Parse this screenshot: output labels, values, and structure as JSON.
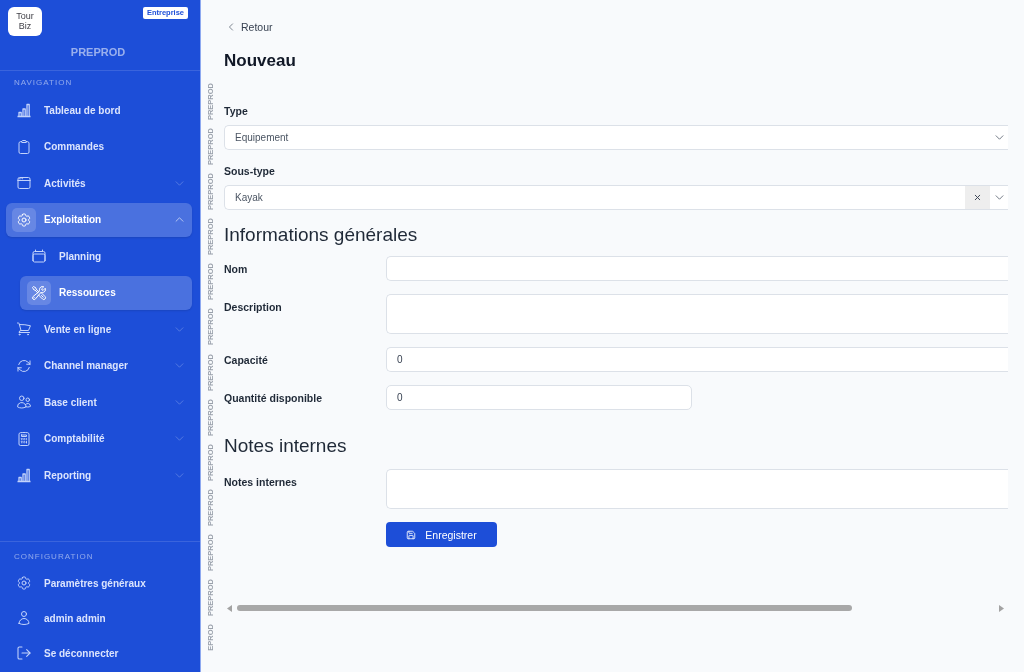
{
  "sidebar": {
    "logo": "Tour Biz",
    "plan_badge": "Entreprise",
    "environment": "PREPROD",
    "sections": [
      {
        "title": "NAVIGATION",
        "items": [
          {
            "label": "Tableau de bord",
            "selected": false
          },
          {
            "label": "Commandes",
            "selected": false
          },
          {
            "label": "Activités",
            "selected": false,
            "expanded": false
          },
          {
            "label": "Exploitation",
            "selected": true,
            "expanded": true,
            "children": [
              {
                "label": "Planning",
                "selected": false
              },
              {
                "label": "Ressources",
                "selected": true
              }
            ]
          },
          {
            "label": "Vente en ligne",
            "selected": false,
            "expanded": false
          },
          {
            "label": "Channel manager",
            "selected": false,
            "expanded": false
          },
          {
            "label": "Base client",
            "selected": false,
            "expanded": false
          },
          {
            "label": "Comptabilité",
            "selected": false,
            "expanded": false
          },
          {
            "label": "Reporting",
            "selected": false,
            "expanded": false
          }
        ]
      },
      {
        "title": "CONFIGURATION",
        "items": [
          {
            "label": "Paramètres généraux",
            "selected": false
          },
          {
            "label": "admin admin",
            "selected": false
          },
          {
            "label": "Se déconnecter",
            "selected": false
          }
        ]
      }
    ]
  },
  "environment_strip": [
    "PREPROD",
    "PREPROD",
    "PREPROD",
    "PREPROD",
    "PREPROD",
    "PREPROD",
    "PREPROD",
    "PREPROD",
    "PREPROD",
    "PREPROD",
    "PREPROD",
    "PREPROD",
    "EPROD"
  ],
  "main": {
    "back_link": "Retour",
    "title": "Nouveau",
    "selects": [
      {
        "label": "Type",
        "value": "Equipement",
        "clearable": false
      },
      {
        "label": "Sous-type",
        "value": "Kayak",
        "clearable": true
      }
    ],
    "sections": [
      {
        "heading": "Informations générales",
        "fields": [
          {
            "label": "Nom",
            "kind": "input"
          },
          {
            "label": "Description",
            "kind": "textarea"
          },
          {
            "label": "Capacité",
            "kind": "input",
            "value": "0"
          },
          {
            "label": "Quantité disponible",
            "kind": "short_input",
            "value": "0"
          }
        ]
      },
      {
        "heading": "Notes internes",
        "fields": [
          {
            "label": "Notes internes",
            "kind": "textarea"
          }
        ]
      }
    ],
    "save_button": "Enregistrer"
  }
}
